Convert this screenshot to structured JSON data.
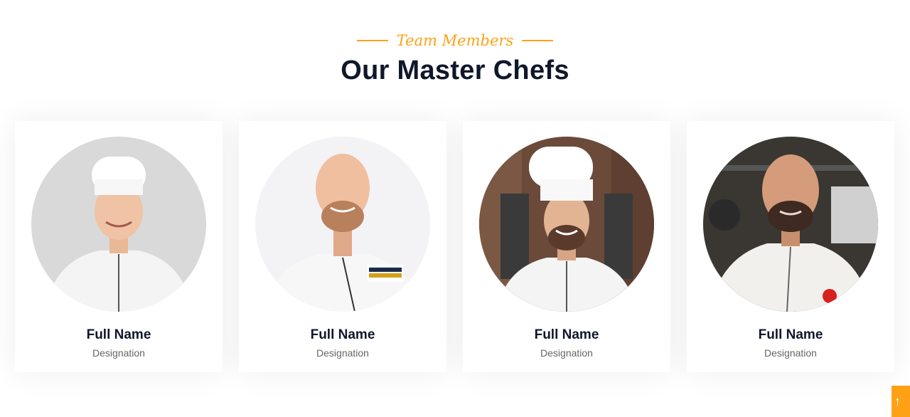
{
  "header": {
    "eyebrow": "Team Members",
    "title": "Our Master Chefs"
  },
  "team": [
    {
      "name": "Full Name",
      "designation": "Designation"
    },
    {
      "name": "Full Name",
      "designation": "Designation"
    },
    {
      "name": "Full Name",
      "designation": "Designation"
    },
    {
      "name": "Full Name",
      "designation": "Designation"
    }
  ],
  "back_to_top": {
    "icon": "arrow-up-icon",
    "glyph": "↑"
  },
  "colors": {
    "accent": "#FEA116",
    "heading": "#0F172B",
    "muted": "#666565"
  }
}
